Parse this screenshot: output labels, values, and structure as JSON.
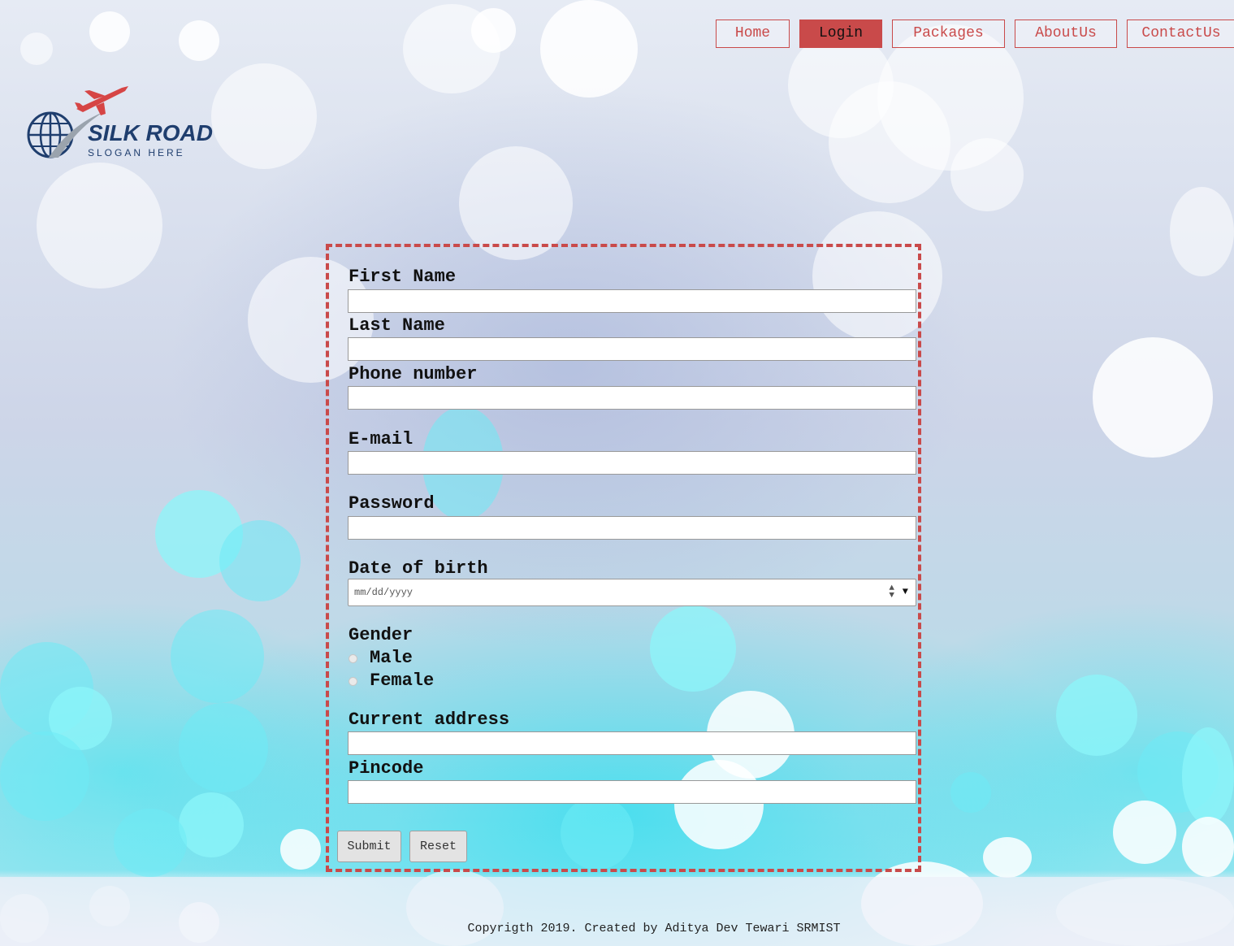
{
  "nav": {
    "items": [
      {
        "label": "Home",
        "active": false
      },
      {
        "label": "Login",
        "active": true
      },
      {
        "label": "Packages",
        "active": false
      },
      {
        "label": "AboutUs",
        "active": false
      },
      {
        "label": "ContactUs",
        "active": false
      }
    ]
  },
  "logo": {
    "title": "SILK ROAD",
    "slogan": "SLOGAN HERE",
    "icon": "airplane-globe-logo"
  },
  "form": {
    "first_name_label": "First Name",
    "last_name_label": "Last Name",
    "phone_label": "Phone number",
    "email_label": "E-mail",
    "password_label": "Password",
    "dob_label": "Date of birth",
    "dob_placeholder": "mm/dd/yyyy",
    "gender_label": "Gender",
    "gender_options": [
      "Male",
      "Female"
    ],
    "address_label": "Current address",
    "pincode_label": "Pincode",
    "submit_label": "Submit",
    "reset_label": "Reset"
  },
  "footer": {
    "copyright": "Copyrigth 2019. Created by Aditya Dev Tewari SRMIST"
  },
  "colors": {
    "accent": "#c94a4a",
    "logo_blue": "#1f3e6e"
  }
}
